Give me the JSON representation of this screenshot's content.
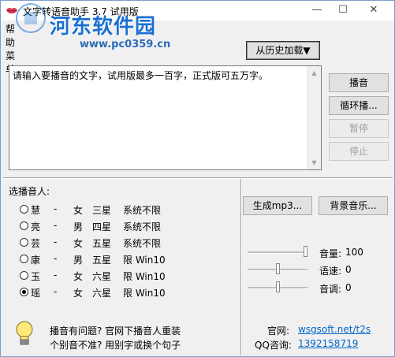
{
  "window": {
    "title": "文字转语音助手 3.7 试用版"
  },
  "watermark": {
    "brand": "河东软件园",
    "url": "www.pc0359.cn"
  },
  "menubar": {
    "help": "帮助菜单"
  },
  "history_button": {
    "label": "从历史加载▼"
  },
  "text_input": {
    "value": "请输入要播音的文字，试用版最多一百字，正式版可五万字。"
  },
  "side_buttons": {
    "play": "播音",
    "loop_play": "循环播...",
    "pause": "暂停",
    "stop": "停止"
  },
  "voice_section": {
    "label": "选播音人:",
    "voices": [
      {
        "name": "慧",
        "dash1": "-",
        "gender": "女",
        "stars": "三星",
        "system": "系统不限",
        "checked": false
      },
      {
        "name": "亮",
        "dash1": "-",
        "gender": "男",
        "stars": "四星",
        "system": "系统不限",
        "checked": false
      },
      {
        "name": "芸",
        "dash1": "-",
        "gender": "女",
        "stars": "五星",
        "system": "系统不限",
        "checked": false
      },
      {
        "name": "康",
        "dash1": "-",
        "gender": "男",
        "stars": "五星",
        "system": "限 Win10",
        "checked": false
      },
      {
        "name": "玉",
        "dash1": "-",
        "gender": "女",
        "stars": "六星",
        "system": "限 Win10",
        "checked": false
      },
      {
        "name": "瑶",
        "dash1": "-",
        "gender": "女",
        "stars": "六星",
        "system": "限 Win10",
        "checked": true
      }
    ]
  },
  "action_buttons": {
    "generate_mp3": "生成mp3...",
    "background_music": "背景音乐..."
  },
  "sliders": {
    "volume": {
      "label": "音量:",
      "value": "100",
      "fraction": 1.0
    },
    "rate": {
      "label": "语速:",
      "value": "0",
      "fraction": 0.5
    },
    "pitch": {
      "label": "音调:",
      "value": "0",
      "fraction": 0.5
    }
  },
  "help_tip": {
    "line1": "播音有问题? 官网下播音人重装",
    "line2": "个别音不准? 用别字或换个句子"
  },
  "contact": {
    "website_label": "官网:",
    "website": "wsgsoft.net/t2s",
    "qq_label": "QQ咨询:",
    "qq": "1392158719"
  }
}
